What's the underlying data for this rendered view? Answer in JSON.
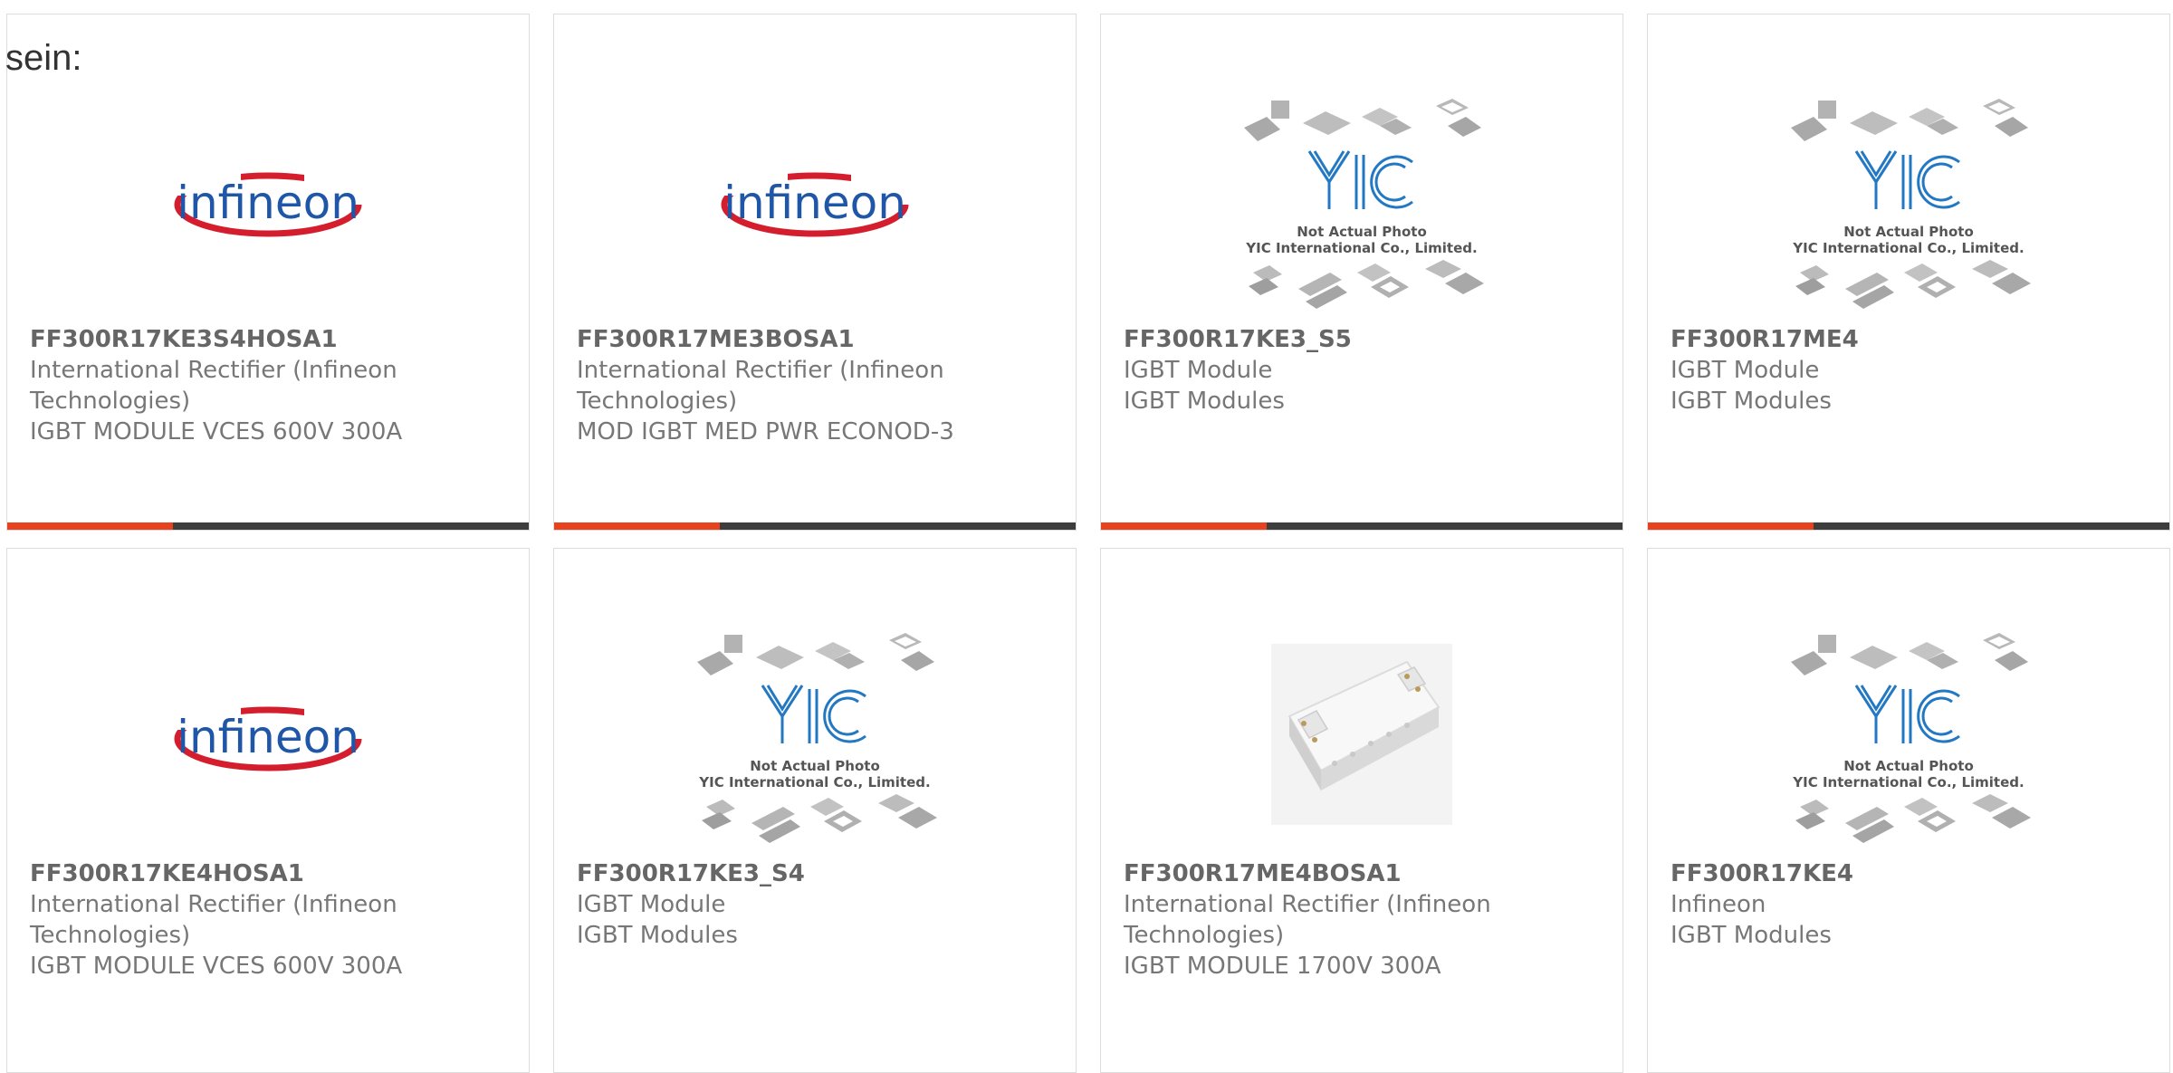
{
  "intro_text": "sein:",
  "logos": {
    "infineon_text": "infineon",
    "yic_text": "YIC",
    "yic_caption_1": "Not Actual Photo",
    "yic_caption_2": "YIC International Co., Limited."
  },
  "colors": {
    "accent": "#e8411d",
    "bar_dark": "#3d3d3d",
    "infineon_red": "#d51e2d",
    "infineon_blue": "#1f56a8",
    "yic_blue": "#2378c3"
  },
  "products": [
    {
      "part": "FF300R17KE3S4HOSA1",
      "manufacturer": "International Rectifier (Infineon Technologies)",
      "description": "IGBT MODULE VCES 600V 300A",
      "image": "infineon-logo"
    },
    {
      "part": "FF300R17ME3BOSA1",
      "manufacturer": "International Rectifier (Infineon Technologies)",
      "description": "MOD IGBT MED PWR ECONOD-3",
      "image": "infineon-logo"
    },
    {
      "part": "FF300R17KE3_S5",
      "manufacturer": "IGBT Module",
      "description": "IGBT Modules",
      "image": "yic-placeholder"
    },
    {
      "part": "FF300R17ME4",
      "manufacturer": "IGBT Module",
      "description": "IGBT Modules",
      "image": "yic-placeholder"
    },
    {
      "part": "FF300R17KE4HOSA1",
      "manufacturer": "International Rectifier (Infineon Technologies)",
      "description": "IGBT MODULE VCES 600V 300A",
      "image": "infineon-logo"
    },
    {
      "part": "FF300R17KE3_S4",
      "manufacturer": "IGBT Module",
      "description": "IGBT Modules",
      "image": "yic-placeholder"
    },
    {
      "part": "FF300R17ME4BOSA1",
      "manufacturer": "International Rectifier (Infineon Technologies)",
      "description": "IGBT MODULE 1700V 300A",
      "image": "igbt-module-photo"
    },
    {
      "part": "FF300R17KE4",
      "manufacturer": "Infineon",
      "description": "IGBT Modules",
      "image": "yic-placeholder"
    }
  ]
}
